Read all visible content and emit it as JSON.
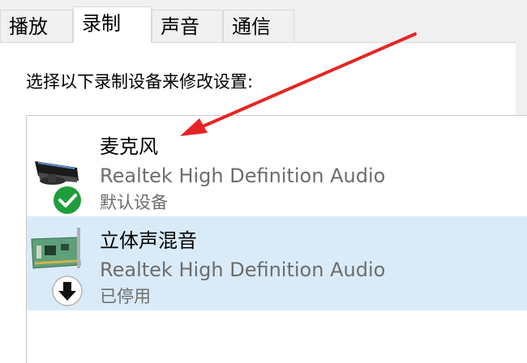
{
  "tabs": [
    {
      "label": "播放"
    },
    {
      "label": "录制",
      "active": true
    },
    {
      "label": "声音"
    },
    {
      "label": "通信"
    }
  ],
  "instruction": "选择以下录制设备来修改设置:",
  "devices": [
    {
      "name": "麦克风",
      "driver": "Realtek High Definition Audio",
      "status": "默认设备",
      "icon": "microphone-icon",
      "status_icon": "default-device-check-icon",
      "selected": false
    },
    {
      "name": "立体声混音",
      "driver": "Realtek High Definition Audio",
      "status": "已停用",
      "icon": "sound-card-icon",
      "status_icon": "disabled-down-arrow-icon",
      "selected": true
    }
  ],
  "colors": {
    "selection": "#d9ebf9",
    "annotation_arrow": "#e62424",
    "check_green": "#1e9e3a"
  }
}
